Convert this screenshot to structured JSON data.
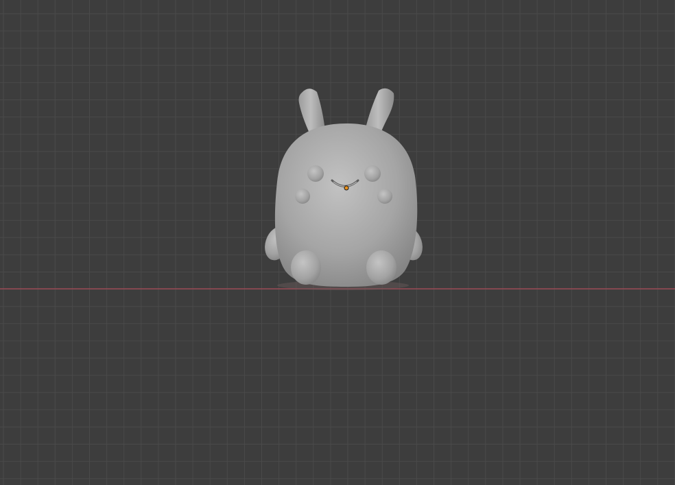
{
  "viewport": {
    "background_color": "#3d3d3d",
    "grid_line_color": "#4a4a4a",
    "x_axis_color": "#9a4a55",
    "origin_color": "#e8901b"
  },
  "scene": {
    "object": "bunny-mascot",
    "material_color": "#a6a6a6",
    "shading": "solid"
  }
}
